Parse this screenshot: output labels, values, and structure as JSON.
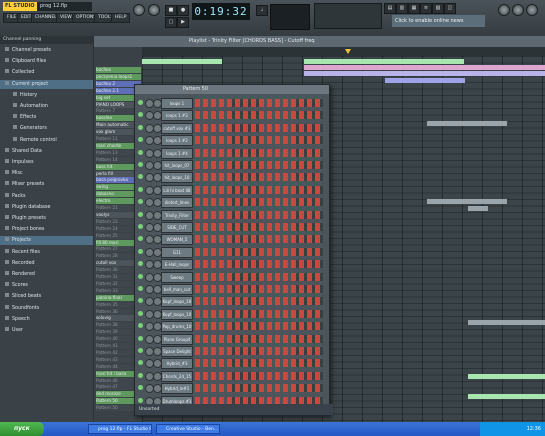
{
  "app": {
    "logo": "FL STUDIO",
    "song_name": "prog 12.flp",
    "menus": [
      "FILE",
      "EDIT",
      "CHANNELS",
      "VIEW",
      "OPTIONS",
      "TOOLS",
      "HELP"
    ],
    "time": "0:19:32",
    "hint": "Click to enable online news"
  },
  "browser": {
    "title": "Channel panning",
    "items": [
      {
        "label": "Channel presets",
        "selected": false,
        "sub": false
      },
      {
        "label": "Clipboard files",
        "selected": false,
        "sub": false
      },
      {
        "label": "Collected",
        "selected": false,
        "sub": false
      },
      {
        "label": "Current project",
        "selected": true,
        "sub": false
      },
      {
        "label": "History",
        "selected": false,
        "sub": true
      },
      {
        "label": "Automation",
        "selected": false,
        "sub": true
      },
      {
        "label": "Effects",
        "selected": false,
        "sub": true
      },
      {
        "label": "Generators",
        "selected": false,
        "sub": true
      },
      {
        "label": "Remote control",
        "selected": false,
        "sub": true
      },
      {
        "label": "Shared Data",
        "selected": false,
        "sub": false
      },
      {
        "label": "Impulses",
        "selected": false,
        "sub": false
      },
      {
        "label": "Misc",
        "selected": false,
        "sub": false
      },
      {
        "label": "Mixer presets",
        "selected": false,
        "sub": false
      },
      {
        "label": "Packs",
        "selected": false,
        "sub": false
      },
      {
        "label": "Plugin database",
        "selected": false,
        "sub": false
      },
      {
        "label": "Plugin presets",
        "selected": false,
        "sub": false
      },
      {
        "label": "Project bones",
        "selected": false,
        "sub": false
      },
      {
        "label": "Projects",
        "selected": true,
        "sub": false
      },
      {
        "label": "Recent files",
        "selected": false,
        "sub": false
      },
      {
        "label": "Recorded",
        "selected": false,
        "sub": false
      },
      {
        "label": "Rendered",
        "selected": false,
        "sub": false
      },
      {
        "label": "Scores",
        "selected": false,
        "sub": false
      },
      {
        "label": "Sliced beats",
        "selected": false,
        "sub": false
      },
      {
        "label": "Soundfonts",
        "selected": false,
        "sub": false
      },
      {
        "label": "Speech",
        "selected": false,
        "sub": false
      },
      {
        "label": "User",
        "selected": false,
        "sub": false
      }
    ]
  },
  "playlist": {
    "title": "Playlist - Trinity Filter [CHORDS BASS] - Cutoff freq",
    "tracks": [
      {
        "label": "bochke",
        "style": "g"
      },
      {
        "label": "peczyenia loops1",
        "style": "g"
      },
      {
        "label": "bochko 2",
        "style": "b"
      },
      {
        "label": "bochko 2.1",
        "style": "b"
      },
      {
        "label": "big set",
        "style": "g"
      },
      {
        "label": "PIANO LOOPS",
        "style": "n"
      },
      {
        "label": "Pattern 7",
        "style": "dim"
      },
      {
        "label": "basslne",
        "style": "g"
      },
      {
        "label": "Main automatic",
        "style": "n"
      },
      {
        "label": "vox glam",
        "style": "n"
      },
      {
        "label": "Pattern 11",
        "style": "dim"
      },
      {
        "label": "mari chorde",
        "style": "g"
      },
      {
        "label": "Pattern 13",
        "style": "dim"
      },
      {
        "label": "Pattern 14",
        "style": "dim"
      },
      {
        "label": "bass hit",
        "style": "g"
      },
      {
        "label": "perla fill",
        "style": "n"
      },
      {
        "label": "basa poigrovka",
        "style": "b"
      },
      {
        "label": "swing",
        "style": "g"
      },
      {
        "label": "dobasno",
        "style": "g"
      },
      {
        "label": "electro",
        "style": "g"
      },
      {
        "label": "Pattern 21",
        "style": "dim"
      },
      {
        "label": "voolys",
        "style": "n"
      },
      {
        "label": "Pattern 23",
        "style": "dim"
      },
      {
        "label": "Pattern 24",
        "style": "dim"
      },
      {
        "label": "Pattern 25",
        "style": "dim"
      },
      {
        "label": "fill 80 mari",
        "style": "g"
      },
      {
        "label": "Pattern 27",
        "style": "dim"
      },
      {
        "label": "Pattern 28",
        "style": "dim"
      },
      {
        "label": "cutoll vox",
        "style": "n"
      },
      {
        "label": "Pattern 30",
        "style": "dim"
      },
      {
        "label": "Pattern 31",
        "style": "dim"
      },
      {
        "label": "Pattern 32",
        "style": "dim"
      },
      {
        "label": "Pattern 33",
        "style": "dim"
      },
      {
        "label": "pianino final",
        "style": "g"
      },
      {
        "label": "Pattern 35",
        "style": "dim"
      },
      {
        "label": "Pattern 36",
        "style": "dim"
      },
      {
        "label": "solovig",
        "style": "n"
      },
      {
        "label": "Pattern 38",
        "style": "dim"
      },
      {
        "label": "Pattern 39",
        "style": "dim"
      },
      {
        "label": "Pattern 40",
        "style": "dim"
      },
      {
        "label": "Pattern 41",
        "style": "dim"
      },
      {
        "label": "Pattern 42",
        "style": "dim"
      },
      {
        "label": "Pattern 43",
        "style": "dim"
      },
      {
        "label": "Pattern 44",
        "style": "dim"
      },
      {
        "label": "mari hit i basa",
        "style": "g"
      },
      {
        "label": "Pattern 46",
        "style": "dim"
      },
      {
        "label": "Pattern 47",
        "style": "dim"
      },
      {
        "label": "ded moroze",
        "style": "g"
      },
      {
        "label": "Pattern 50",
        "style": "g"
      },
      {
        "label": "Pattern 50",
        "style": "dim"
      }
    ]
  },
  "stepseq": {
    "title": "Pattern 50",
    "channels": [
      "loops 1",
      "loops 1 #3",
      "cutoff vox #3",
      "loops 1 #2",
      "loops 1 #4",
      "hit_loops_07",
      "hit_loops_10",
      "Lili hi beat 08",
      "distort_lines",
      "Trinity_Filter",
      "SIDE_CUT",
      "WOMAN_5",
      "G11",
      "E-Hall_loops",
      "Sweep",
      "bell_man_cut",
      "Kopf_loops_18",
      "Kopf_loops_10",
      "Pop_drums_10",
      "Piano Group4",
      "Space Delight",
      "Hybrid_#3",
      "Chords_24_15",
      "Hybrid_lo#1",
      "Drumloops #1"
    ],
    "footer": "Unsorted"
  },
  "taskbar": {
    "start": "пуск",
    "tasks": [
      "prog 12.flp - FL Studio 9",
      "Creative Studio - Ben..."
    ],
    "clock": "12:36"
  }
}
